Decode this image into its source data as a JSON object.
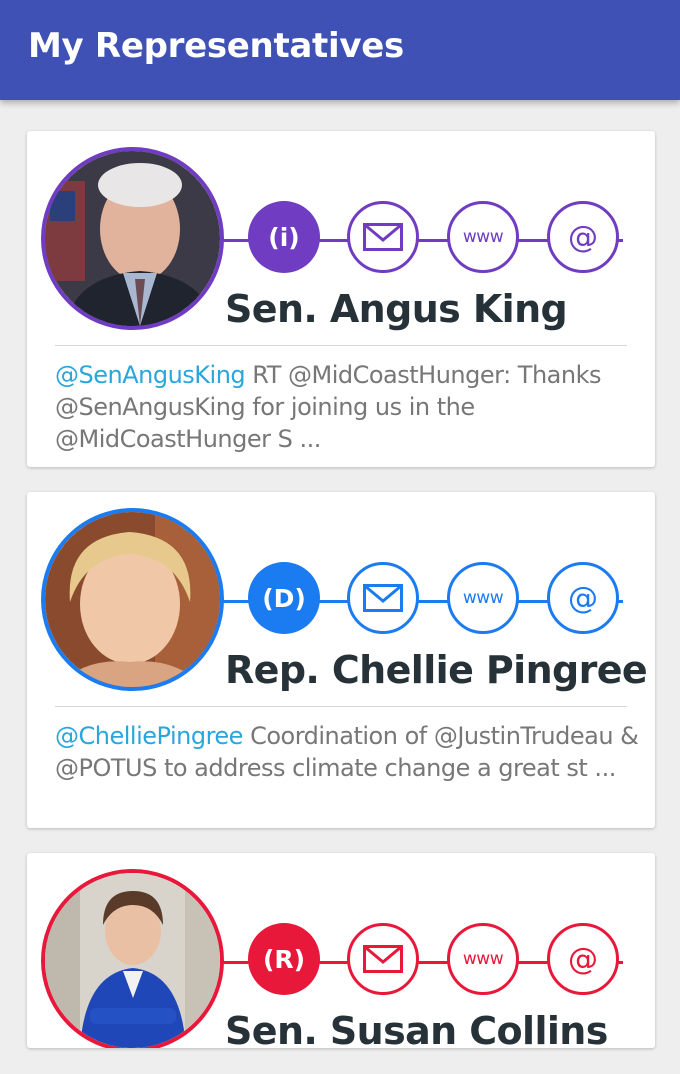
{
  "app": {
    "title": "My Representatives"
  },
  "reps": [
    {
      "name": "Sen. Angus King",
      "party_label": "(i)",
      "accent": "#6f3cc2",
      "icons": [
        "info-icon",
        "mail-icon",
        "website-icon",
        "at-icon"
      ],
      "www_label": "www",
      "at_label": "@",
      "tweet_handle": "@SenAngusKing",
      "tweet_text": "RT @MidCoastHunger: Thanks @SenAngusKing for joining us in the @MidCoastHunger S ..."
    },
    {
      "name": "Rep. Chellie Pingree",
      "party_label": "(D)",
      "accent": "#1b7bf0",
      "icons": [
        "democrat-icon",
        "mail-icon",
        "website-icon",
        "at-icon"
      ],
      "www_label": "www",
      "at_label": "@",
      "tweet_handle": "@ChelliePingree",
      "tweet_text": "Coordination of @JustinTrudeau & @POTUS to address climate change a great st ..."
    },
    {
      "name": "Sen. Susan Collins",
      "party_label": "(R)",
      "accent": "#e8183a",
      "icons": [
        "republican-icon",
        "mail-icon",
        "website-icon",
        "at-icon"
      ],
      "www_label": "www",
      "at_label": "@"
    }
  ]
}
